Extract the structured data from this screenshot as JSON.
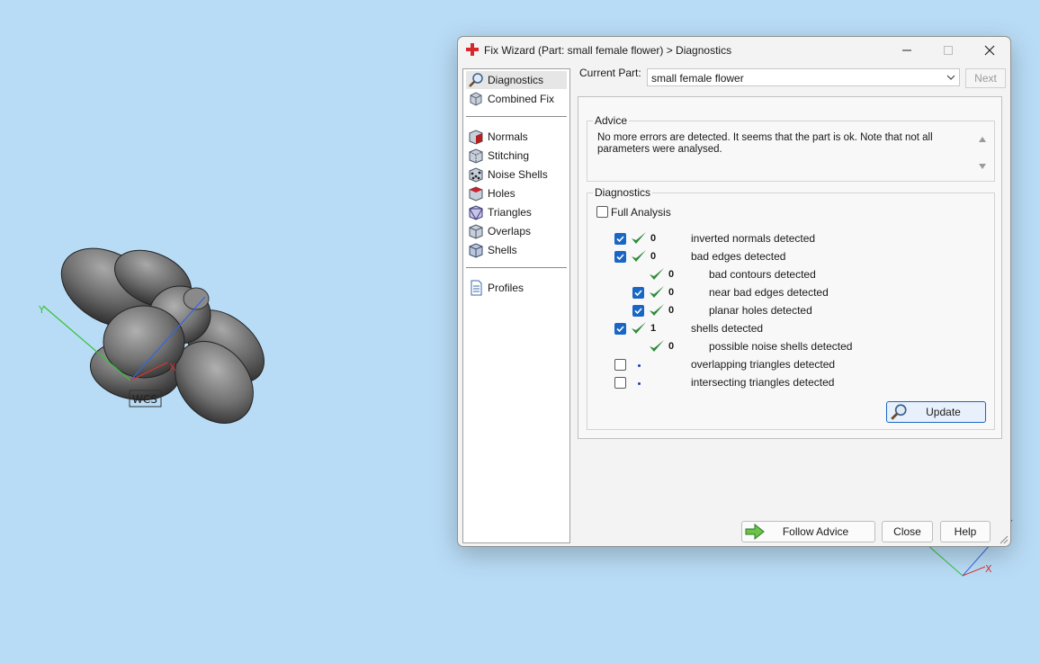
{
  "window": {
    "title": "Fix Wizard (Part: small female flower) > Diagnostics"
  },
  "viewport": {
    "wcs_label": "WCS",
    "axes": {
      "x": "X",
      "y": "Y"
    }
  },
  "nav": {
    "items": [
      {
        "label": "Diagnostics",
        "icon": "magnifier-icon",
        "selected": true
      },
      {
        "label": "Combined Fix",
        "icon": "combined-fix-icon"
      },
      {
        "label": "Normals",
        "icon": "normals-icon"
      },
      {
        "label": "Stitching",
        "icon": "stitching-icon"
      },
      {
        "label": "Noise Shells",
        "icon": "noise-shells-icon"
      },
      {
        "label": "Holes",
        "icon": "holes-icon"
      },
      {
        "label": "Triangles",
        "icon": "triangles-icon"
      },
      {
        "label": "Overlaps",
        "icon": "overlaps-icon"
      },
      {
        "label": "Shells",
        "icon": "shells-icon"
      },
      {
        "label": "Profiles",
        "icon": "profiles-icon"
      }
    ]
  },
  "current_part": {
    "label": "Current Part:",
    "value": "small female flower"
  },
  "next_label": "Next",
  "advice": {
    "title": "Advice",
    "text": "No more errors are detected. It seems that the part is ok. Note that not all parameters were analysed."
  },
  "diagnostics": {
    "title": "Diagnostics",
    "full_analysis": {
      "label": "Full Analysis",
      "checked": false
    },
    "rows": [
      {
        "checked": true,
        "ok": true,
        "count": "0",
        "label": "inverted normals detected"
      },
      {
        "checked": true,
        "ok": true,
        "count": "0",
        "label": "bad edges detected"
      },
      {
        "checked": null,
        "ok": true,
        "count": "0",
        "label": "bad contours detected"
      },
      {
        "checked": true,
        "ok": true,
        "count": "0",
        "label": "near bad edges detected"
      },
      {
        "checked": true,
        "ok": true,
        "count": "0",
        "label": "planar holes detected"
      },
      {
        "checked": true,
        "ok": true,
        "count": "1",
        "label": "shells detected"
      },
      {
        "checked": null,
        "ok": true,
        "count": "0",
        "label": "possible noise shells detected"
      },
      {
        "checked": false,
        "ok": false,
        "count": "",
        "label": "overlapping triangles detected"
      },
      {
        "checked": false,
        "ok": false,
        "count": "",
        "label": "intersecting triangles detected"
      }
    ],
    "update_label": "Update"
  },
  "footer": {
    "follow_advice": "Follow Advice",
    "close": "Close",
    "help": "Help"
  },
  "colors": {
    "accent": "#1967c4",
    "check": "#2e8b3a",
    "background": "#b9dcf6"
  }
}
